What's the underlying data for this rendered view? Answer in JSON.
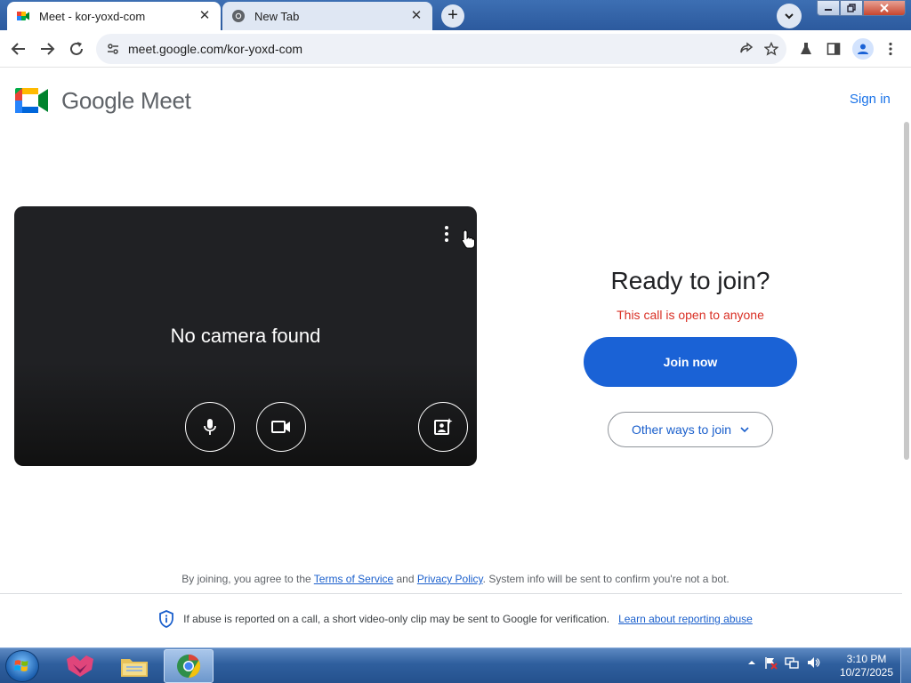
{
  "browser": {
    "tabs": [
      {
        "title": "Meet - kor-yoxd-com",
        "icon": "google-meet-icon",
        "active": true
      },
      {
        "title": "New Tab",
        "icon": "chrome-icon",
        "active": false
      }
    ],
    "new_tab_label": "+",
    "url": "meet.google.com/kor-yoxd-com",
    "close_glyph": "✕"
  },
  "page": {
    "brand_name": "Google Meet",
    "sign_in": "Sign in",
    "preview": {
      "message": "No camera found"
    },
    "join": {
      "heading": "Ready to join?",
      "status": "This call is open to anyone",
      "join_now": "Join now",
      "other_ways": "Other ways to join"
    },
    "footer": {
      "terms_prefix": "By joining, you agree to the ",
      "terms_link": "Terms of Service",
      "terms_and": " and ",
      "privacy_link": "Privacy Policy",
      "terms_suffix": ". System info will be sent to confirm you're not a bot.",
      "abuse_text": "If abuse is reported on a call, a short video-only clip may be sent to Google for verification.",
      "abuse_link": "Learn about reporting abuse"
    }
  },
  "taskbar": {
    "time": "3:10 PM",
    "date": "10/27/2025"
  },
  "colors": {
    "accent": "#1a62d6",
    "link": "#1a5fcc",
    "warning": "#d93025"
  }
}
